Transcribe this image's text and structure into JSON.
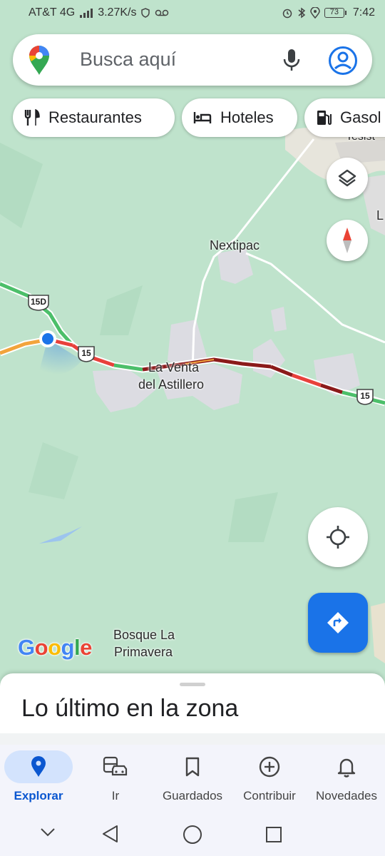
{
  "status_bar": {
    "carrier": "AT&T 4G",
    "net_badge": "4G",
    "speed": "3.27K/s",
    "battery": "73",
    "time": "7:42"
  },
  "search": {
    "placeholder": "Busca aquí"
  },
  "chips": [
    {
      "label": "Restaurantes",
      "icon": "fork-knife-icon"
    },
    {
      "label": "Hoteles",
      "icon": "bed-icon"
    },
    {
      "label": "Gasol",
      "icon": "gas-station-icon"
    }
  ],
  "map": {
    "labels": {
      "nextipac": "Nextipac",
      "la_venta_1": "La Venta",
      "la_venta_2": "del Astillero",
      "bosque_1": "Bosque La",
      "bosque_2": "Primavera",
      "partial_top": "Tesist",
      "partial_right": "L"
    },
    "shields": {
      "route_15d": "15D",
      "route_15_a": "15",
      "route_15_b": "15"
    },
    "attribution_logo": "Google"
  },
  "bottom_sheet": {
    "title": "Lo último en la zona"
  },
  "bottom_nav": {
    "items": [
      {
        "label": "Explorar",
        "icon": "location-pin-icon",
        "active": true
      },
      {
        "label": "Ir",
        "icon": "commute-icon",
        "active": false
      },
      {
        "label": "Guardados",
        "icon": "bookmark-icon",
        "active": false
      },
      {
        "label": "Contribuir",
        "icon": "add-circle-icon",
        "active": false
      },
      {
        "label": "Novedades",
        "icon": "bell-icon",
        "active": false
      }
    ]
  },
  "colors": {
    "accent": "#1a73e8",
    "active_nav_bg": "#d3e3fd",
    "active_nav_text": "#0b57d0",
    "map_green": "#bfe3cc",
    "traffic_green": "#4cbf6a",
    "traffic_red": "#e8413b",
    "traffic_darkred": "#8b1a1a"
  }
}
